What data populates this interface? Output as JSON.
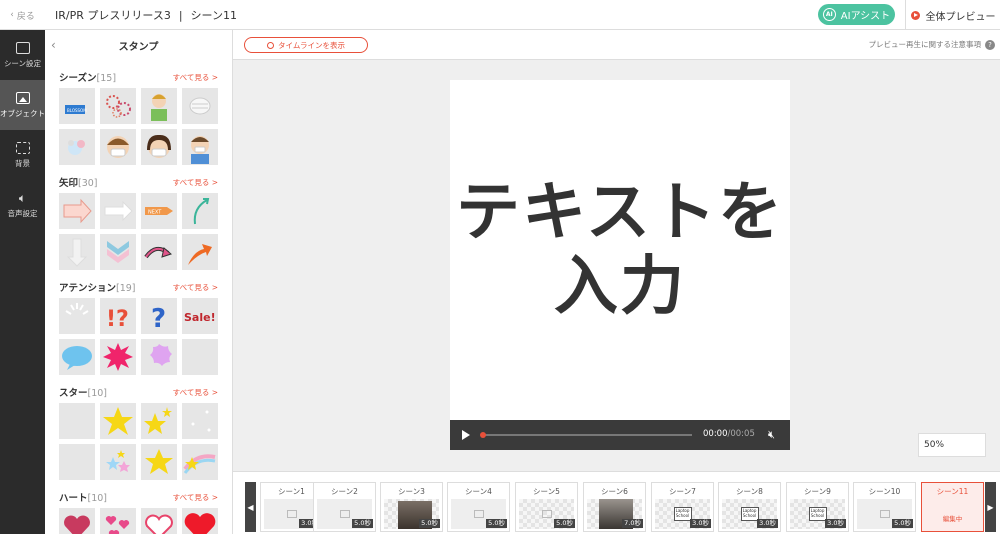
{
  "header": {
    "back_label": "戻る",
    "project_title": "IR/PR プレスリリース3",
    "separator": "|",
    "scene_title": "シーン11",
    "ai_assist_label": "AIアシスト",
    "ai_icon_text": "AI",
    "preview_all_label": "全体プレビュー",
    "colors": {
      "accent": "#e8503a",
      "ai": "#4cc3a0",
      "rail": "#2b2b2b"
    }
  },
  "rail": {
    "items": [
      {
        "label": "シーン設定",
        "icon": "scene-settings-icon"
      },
      {
        "label": "オブジェクト",
        "icon": "object-icon",
        "active": true
      },
      {
        "label": "背景",
        "icon": "background-icon"
      },
      {
        "label": "音声設定",
        "icon": "sound-icon"
      }
    ]
  },
  "panel": {
    "title": "スタンプ",
    "see_all": "すべて見る >",
    "sections": [
      {
        "title": "シーズン",
        "count": "[15]"
      },
      {
        "title": "矢印",
        "count": "[30]"
      },
      {
        "title": "アテンション",
        "count": "[19]"
      },
      {
        "title": "スター",
        "count": "[10]"
      },
      {
        "title": "ハート",
        "count": "[10]"
      }
    ],
    "stamp_text": {
      "sale": "Sale!",
      "next": "NEXT",
      "exclaim_q": "!?",
      "question": "?"
    }
  },
  "toolbar": {
    "timeline_button": "タイムラインを表示",
    "preview_notice": "プレビュー再生に関する注意事項",
    "help": "?"
  },
  "stage": {
    "text": "テキストを\n入力"
  },
  "player": {
    "current_time": "00:00",
    "duration": "/00:05"
  },
  "zoom": {
    "value": "50%"
  },
  "scenes": [
    {
      "label": "シーン1",
      "duration": "3.0秒",
      "thumb": "image-placeholder"
    },
    {
      "label": "シーン2",
      "duration": "5.0秒",
      "thumb": "image-placeholder"
    },
    {
      "label": "シーン3",
      "duration": "5.0秒",
      "thumb": "photo"
    },
    {
      "label": "シーン4",
      "duration": "5.0秒",
      "thumb": "image-placeholder"
    },
    {
      "label": "シーン5",
      "duration": "5.0秒",
      "thumb": "checker"
    },
    {
      "label": "シーン6",
      "duration": "7.0秒",
      "thumb": "photo"
    },
    {
      "label": "シーン7",
      "duration": "3.0秒",
      "thumb": "laptop"
    },
    {
      "label": "シーン8",
      "duration": "3.0秒",
      "thumb": "laptop"
    },
    {
      "label": "シーン9",
      "duration": "3.0秒",
      "thumb": "laptop"
    },
    {
      "label": "シーン10",
      "duration": "5.0秒",
      "thumb": "image-placeholder"
    },
    {
      "label": "シーン11",
      "editing": "編集中",
      "active": true
    }
  ],
  "laptop_text": "Laptop School"
}
